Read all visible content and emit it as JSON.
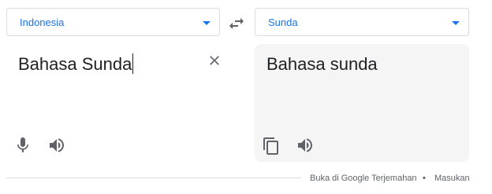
{
  "source_language": {
    "label": "Indonesia",
    "icon": "chevron-down-icon"
  },
  "target_language": {
    "label": "Sunda",
    "icon": "chevron-down-icon"
  },
  "swap": {
    "icon": "swap-arrows-icon"
  },
  "source": {
    "text": "Bahasa Sunda",
    "clear_icon": "close-icon",
    "mic_icon": "microphone-icon",
    "speaker_icon": "speaker-icon"
  },
  "target": {
    "text": "Bahasa sunda",
    "copy_icon": "copy-icon",
    "speaker_icon": "speaker-icon"
  },
  "footer": {
    "open_link": "Buka di Google Terjemahan",
    "separator": "•",
    "feedback_link": "Masukan"
  },
  "colors": {
    "accent": "#1a73e8",
    "text": "#202124",
    "icon": "#5f6368",
    "border": "#dadce0",
    "target_background": "#f5f5f5"
  }
}
